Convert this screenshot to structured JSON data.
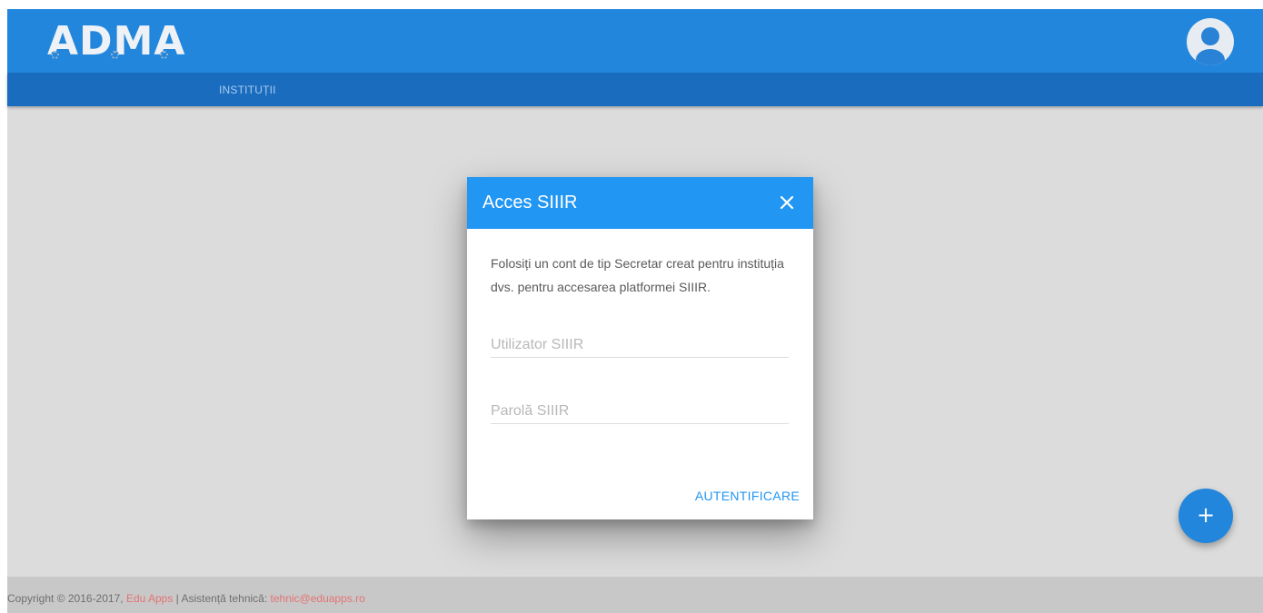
{
  "header": {
    "logo_text": "ADMA",
    "avatar_icon": "user-avatar-icon"
  },
  "nav": {
    "items": [
      {
        "label": "INSTITUȚII"
      }
    ]
  },
  "dialog": {
    "title": "Acces SIIIR",
    "close_icon": "close-icon",
    "description": "Folosiți un cont de tip Secretar creat pentru instituția dvs. pentru accesarea platformei SIIIR.",
    "username_placeholder": "Utilizator SIIIR",
    "password_placeholder": "Parolă SIIIR",
    "submit_label": "AUTENTIFICARE"
  },
  "fab": {
    "label": "+",
    "icon": "add-icon"
  },
  "footer": {
    "copyright": "Copyright © 2016-2017,",
    "company_link": "Edu Apps",
    "support_label": "| Asistență tehnică:",
    "support_email": "tehnic@eduapps.ro"
  },
  "colors": {
    "primary": "#2287dc",
    "primary_dark": "#1a6cbf",
    "dialog_header": "#2196f3",
    "link_accent": "#e57373",
    "background": "#dcdcdc"
  }
}
